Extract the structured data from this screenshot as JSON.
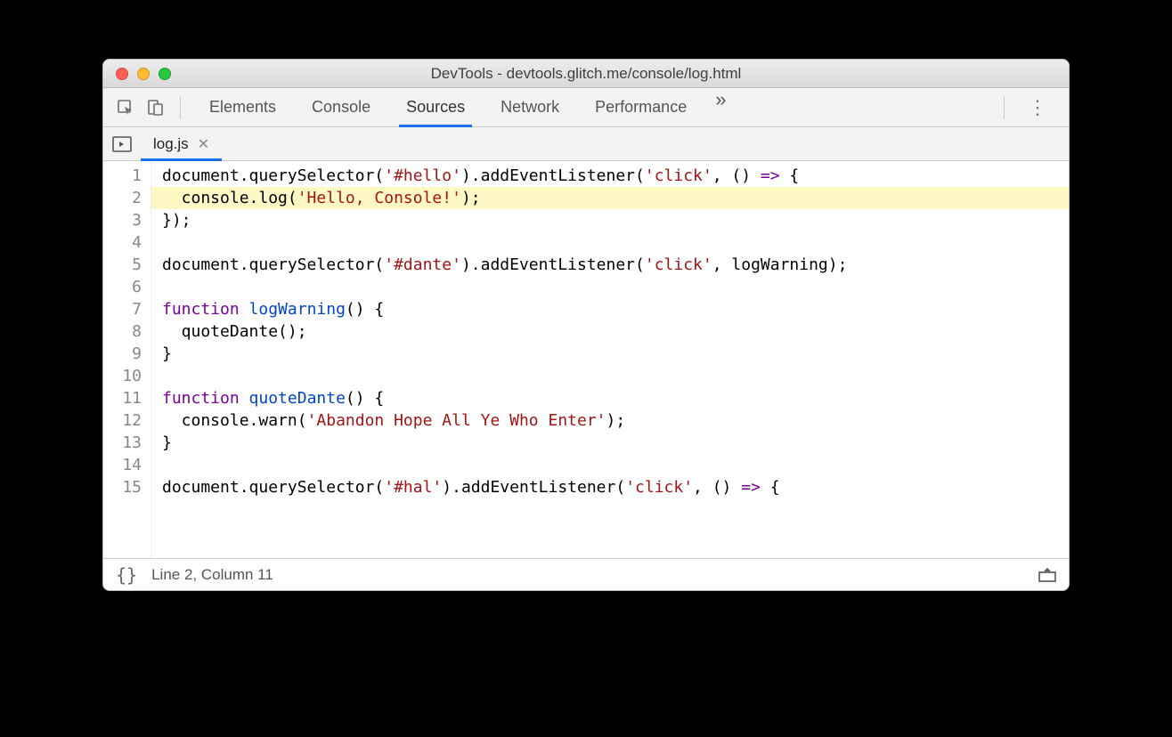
{
  "window": {
    "title": "DevTools - devtools.glitch.me/console/log.html"
  },
  "toolbar": {
    "tabs": [
      "Elements",
      "Console",
      "Sources",
      "Network",
      "Performance"
    ],
    "active_tab_index": 2
  },
  "filetab": {
    "name": "log.js"
  },
  "code": {
    "lines": [
      {
        "n": 1,
        "hl": false,
        "tokens": [
          [
            "",
            "document.querySelector("
          ],
          [
            "str",
            "'#hello'"
          ],
          [
            "",
            ").addEventListener("
          ],
          [
            "str",
            "'click'"
          ],
          [
            "",
            ", () "
          ],
          [
            "kw",
            "=>"
          ],
          [
            "",
            " {"
          ]
        ]
      },
      {
        "n": 2,
        "hl": true,
        "tokens": [
          [
            "",
            "  console.log("
          ],
          [
            "str",
            "'Hello, Console!'"
          ],
          [
            "",
            ");"
          ]
        ]
      },
      {
        "n": 3,
        "hl": false,
        "tokens": [
          [
            "",
            "});"
          ]
        ]
      },
      {
        "n": 4,
        "hl": false,
        "tokens": [
          [
            "",
            ""
          ]
        ]
      },
      {
        "n": 5,
        "hl": false,
        "tokens": [
          [
            "",
            "document.querySelector("
          ],
          [
            "str",
            "'#dante'"
          ],
          [
            "",
            ").addEventListener("
          ],
          [
            "str",
            "'click'"
          ],
          [
            "",
            ", logWarning);"
          ]
        ]
      },
      {
        "n": 6,
        "hl": false,
        "tokens": [
          [
            "",
            ""
          ]
        ]
      },
      {
        "n": 7,
        "hl": false,
        "tokens": [
          [
            "kw",
            "function"
          ],
          [
            "",
            " "
          ],
          [
            "fn",
            "logWarning"
          ],
          [
            "",
            "() {"
          ]
        ]
      },
      {
        "n": 8,
        "hl": false,
        "tokens": [
          [
            "",
            "  quoteDante();"
          ]
        ]
      },
      {
        "n": 9,
        "hl": false,
        "tokens": [
          [
            "",
            "}"
          ]
        ]
      },
      {
        "n": 10,
        "hl": false,
        "tokens": [
          [
            "",
            ""
          ]
        ]
      },
      {
        "n": 11,
        "hl": false,
        "tokens": [
          [
            "kw",
            "function"
          ],
          [
            "",
            " "
          ],
          [
            "fn",
            "quoteDante"
          ],
          [
            "",
            "() {"
          ]
        ]
      },
      {
        "n": 12,
        "hl": false,
        "tokens": [
          [
            "",
            "  console.warn("
          ],
          [
            "str",
            "'Abandon Hope All Ye Who Enter'"
          ],
          [
            "",
            ");"
          ]
        ]
      },
      {
        "n": 13,
        "hl": false,
        "tokens": [
          [
            "",
            "}"
          ]
        ]
      },
      {
        "n": 14,
        "hl": false,
        "tokens": [
          [
            "",
            ""
          ]
        ]
      },
      {
        "n": 15,
        "hl": false,
        "tokens": [
          [
            "",
            "document.querySelector("
          ],
          [
            "str",
            "'#hal'"
          ],
          [
            "",
            ").addEventListener("
          ],
          [
            "str",
            "'click'"
          ],
          [
            "",
            ", () "
          ],
          [
            "kw",
            "=>"
          ],
          [
            "",
            " {"
          ]
        ]
      }
    ]
  },
  "status": {
    "cursor": "Line 2, Column 11"
  }
}
